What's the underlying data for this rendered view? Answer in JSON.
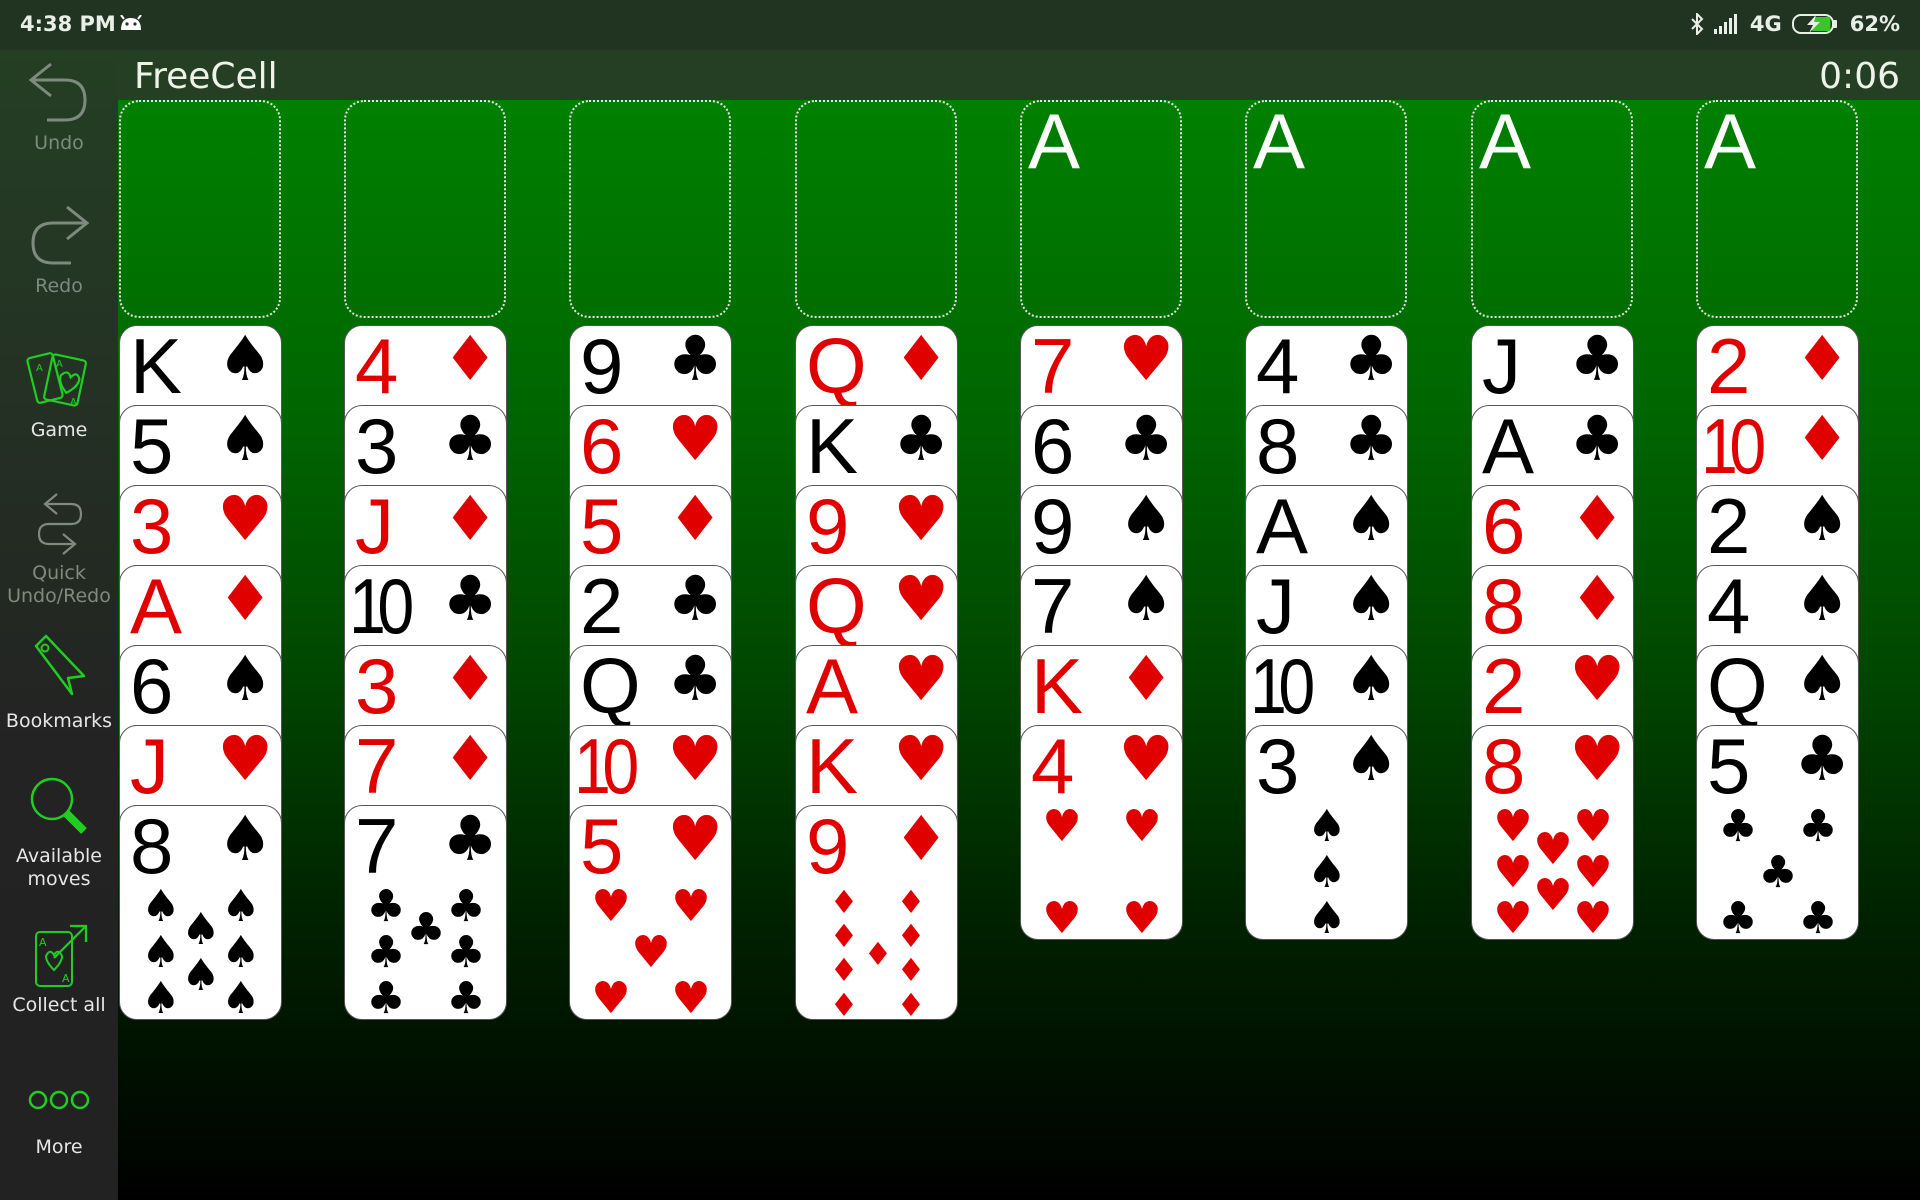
{
  "status_bar": {
    "time": "4:38 PM",
    "notification_icon": "android-icon",
    "network": "4G",
    "battery_percent": "62%",
    "battery_charging": true,
    "bluetooth": true
  },
  "header": {
    "title": "FreeCell",
    "timer": "0:06"
  },
  "sidebar": {
    "items": [
      {
        "label": "Undo",
        "icon": "undo-icon",
        "enabled": false
      },
      {
        "label": "Redo",
        "icon": "redo-icon",
        "enabled": false
      },
      {
        "label": "Game",
        "icon": "cards-icon",
        "enabled": true
      },
      {
        "label": "Quick Undo/Redo",
        "icon": "quick-undo-redo-icon",
        "enabled": false
      },
      {
        "label": "Bookmarks",
        "icon": "bookmark-icon",
        "enabled": true
      },
      {
        "label": "Available moves",
        "icon": "search-icon",
        "enabled": true
      },
      {
        "label": "Collect all",
        "icon": "collect-all-icon",
        "enabled": true
      },
      {
        "label": "More",
        "icon": "more-icon",
        "enabled": true
      }
    ]
  },
  "free_cells": [
    {
      "card": null
    },
    {
      "card": null
    },
    {
      "card": null
    },
    {
      "card": null
    }
  ],
  "foundations": [
    {
      "label": "A",
      "card": null
    },
    {
      "label": "A",
      "card": null
    },
    {
      "label": "A",
      "card": null
    },
    {
      "label": "A",
      "card": null
    }
  ],
  "colors": {
    "red_suit": "#e00000",
    "black_suit": "#000000",
    "accent_green": "#22cc22",
    "table_top": "#008000"
  },
  "tableau": [
    [
      {
        "rank": "K",
        "suit": "spades"
      },
      {
        "rank": "5",
        "suit": "spades"
      },
      {
        "rank": "3",
        "suit": "hearts"
      },
      {
        "rank": "A",
        "suit": "diamonds"
      },
      {
        "rank": "6",
        "suit": "spades"
      },
      {
        "rank": "J",
        "suit": "hearts"
      },
      {
        "rank": "8",
        "suit": "spades"
      }
    ],
    [
      {
        "rank": "4",
        "suit": "diamonds"
      },
      {
        "rank": "3",
        "suit": "clubs"
      },
      {
        "rank": "J",
        "suit": "diamonds"
      },
      {
        "rank": "10",
        "suit": "clubs"
      },
      {
        "rank": "3",
        "suit": "diamonds"
      },
      {
        "rank": "7",
        "suit": "diamonds"
      },
      {
        "rank": "7",
        "suit": "clubs"
      }
    ],
    [
      {
        "rank": "9",
        "suit": "clubs"
      },
      {
        "rank": "6",
        "suit": "hearts"
      },
      {
        "rank": "5",
        "suit": "diamonds"
      },
      {
        "rank": "2",
        "suit": "clubs"
      },
      {
        "rank": "Q",
        "suit": "clubs"
      },
      {
        "rank": "10",
        "suit": "hearts"
      },
      {
        "rank": "5",
        "suit": "hearts"
      }
    ],
    [
      {
        "rank": "Q",
        "suit": "diamonds"
      },
      {
        "rank": "K",
        "suit": "clubs"
      },
      {
        "rank": "9",
        "suit": "hearts"
      },
      {
        "rank": "Q",
        "suit": "hearts"
      },
      {
        "rank": "A",
        "suit": "hearts"
      },
      {
        "rank": "K",
        "suit": "hearts"
      },
      {
        "rank": "9",
        "suit": "diamonds"
      }
    ],
    [
      {
        "rank": "7",
        "suit": "hearts"
      },
      {
        "rank": "6",
        "suit": "clubs"
      },
      {
        "rank": "9",
        "suit": "spades"
      },
      {
        "rank": "7",
        "suit": "spades"
      },
      {
        "rank": "K",
        "suit": "diamonds"
      },
      {
        "rank": "4",
        "suit": "hearts"
      }
    ],
    [
      {
        "rank": "4",
        "suit": "clubs"
      },
      {
        "rank": "8",
        "suit": "clubs"
      },
      {
        "rank": "A",
        "suit": "spades"
      },
      {
        "rank": "J",
        "suit": "spades"
      },
      {
        "rank": "10",
        "suit": "spades"
      },
      {
        "rank": "3",
        "suit": "spades"
      }
    ],
    [
      {
        "rank": "J",
        "suit": "clubs"
      },
      {
        "rank": "A",
        "suit": "clubs"
      },
      {
        "rank": "6",
        "suit": "diamonds"
      },
      {
        "rank": "8",
        "suit": "diamonds"
      },
      {
        "rank": "2",
        "suit": "hearts"
      },
      {
        "rank": "8",
        "suit": "hearts"
      }
    ],
    [
      {
        "rank": "2",
        "suit": "diamonds"
      },
      {
        "rank": "10",
        "suit": "diamonds"
      },
      {
        "rank": "2",
        "suit": "spades"
      },
      {
        "rank": "4",
        "suit": "spades"
      },
      {
        "rank": "Q",
        "suit": "spades"
      },
      {
        "rank": "5",
        "suit": "clubs"
      }
    ]
  ]
}
